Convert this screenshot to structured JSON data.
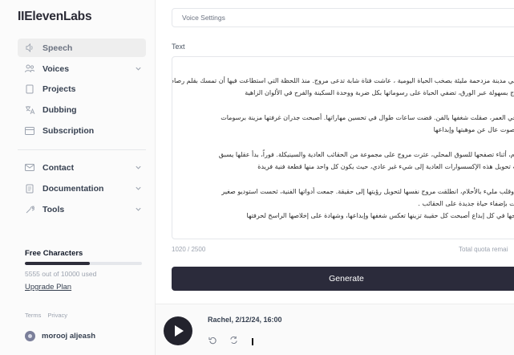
{
  "app": {
    "logo": "IIElevenLabs"
  },
  "sidebar": {
    "nav": [
      {
        "label": "Speech",
        "icon": "speech-icon",
        "active": true
      },
      {
        "label": "Voices",
        "icon": "voices-icon",
        "chevron": true
      },
      {
        "label": "Projects",
        "icon": "projects-icon"
      },
      {
        "label": "Dubbing",
        "icon": "translate-icon"
      },
      {
        "label": "Subscription",
        "icon": "subscription-icon"
      }
    ],
    "nav2": [
      {
        "label": "Contact",
        "icon": "mail-icon",
        "chevron": true
      },
      {
        "label": "Documentation",
        "icon": "document-icon",
        "chevron": true
      },
      {
        "label": "Tools",
        "icon": "tools-icon",
        "chevron": true
      }
    ],
    "free_characters": {
      "title": "Free Characters",
      "used_text": "5555 out of 10000 used",
      "progress": 0.5555,
      "upgrade": "Upgrade Plan"
    },
    "legal": {
      "terms": "Terms",
      "privacy": "Privacy"
    },
    "user": {
      "name": "morooj aljeash"
    }
  },
  "main": {
    "voice_settings": "Voice Settings",
    "text_label": "Text",
    "paragraphs": [
      [
        "في يوم بسيط في مدينة مزدحمة مليئة بصخب الحياة اليومية ، عاشت فتاة شابة تدعى مروج. منذ اللحظة التي استطاعت فيها أن تمسك بقلم رصاص،",
        "بدأت أصابع مروج بسهولة عبر الورق، تضفي الحياة على رسوماتها بكل ضربة ووحدة السكينة والفرح في الألوان الزاهية"
      ],
      [
        "مع تقدم مروج في العمر، صقلت شغفها بالفن. قضت ساعات طوال في تحسين مهاراتها. أصبحت جدران غرفتها مزينة برسومات",
        "ولوحات تنطق بصوت عال عن موهبتها وإبداعها"
      ],
      [
        "في يوم من الأيام، أثناء تصفحها للسوق المحلي، عثرت مروج على مجموعة من الحقائب العادية والسينيكلة. فوراً، بدأ عقلها يسبق",
        "بالأفكار. تصورت تحويل هذه الإكسسوارات العادية إلى شيء غير عادي، حيث يكون كل واحد منها قطعة فنية فريدة"
      ],
      [
        "بقرار لا يتزعزع وقلب مليء بالأحلام، انطلقت مروج نفسها لتحويل رؤيتها إلى حقيقة. جمعت أدواتها الفنية، ثحست استوديو صغير",
        "في منزلها، وبدأت بإضفاء حياة جديدة على الحقائب .",
        "جعلت مروج روحها في كل إبداع أصبحت كل حقيبة تزينها تعكس شغفها وإبداعها، وشهادة على إخلاصها الراسخ لحرفتها"
      ]
    ],
    "char_count": "1020 / 2500",
    "quota": "Total quota remai",
    "generate_label": "Generate"
  },
  "player": {
    "title": "Rachel, 2/12/24, 16:00"
  },
  "colors": {
    "primary_dark": "#2b2b3b",
    "sidebar_bg": "#fbfbfb",
    "active_bg": "#eeeeee"
  }
}
